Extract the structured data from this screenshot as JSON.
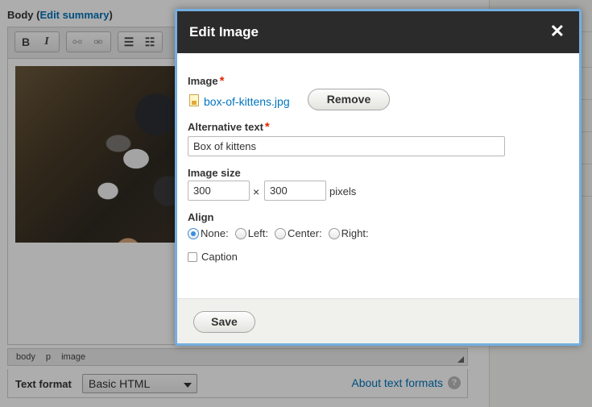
{
  "editor": {
    "body_label": "Body",
    "edit_summary_link": "Edit summary",
    "status_path": [
      "body",
      "p",
      "image"
    ],
    "text_format_label": "Text format",
    "text_format_value": "Basic HTML",
    "about_formats_link": "About text formats",
    "help_glyph": "?"
  },
  "toolbar": {
    "bold": "B",
    "italic": "I",
    "link_icon": "link-icon",
    "unlink_icon": "unlink-icon",
    "bullet_icon": "bulleted-list-icon",
    "number_icon": "numbered-list-icon"
  },
  "dialog": {
    "title": "Edit Image",
    "close_glyph": "✕",
    "image_label": "Image",
    "required_mark": "*",
    "file_name": "box-of-kittens.jpg",
    "remove_button": "Remove",
    "alt_label": "Alternative text",
    "alt_value": "Box of kittens",
    "size_label": "Image size",
    "width_value": "300",
    "height_value": "300",
    "times_glyph": "×",
    "pixels_label": "pixels",
    "align_label": "Align",
    "align_options": [
      "None:",
      "Left:",
      "Center:",
      "Right:"
    ],
    "align_selected": "None:",
    "caption_label": "Caption",
    "save_button": "Save"
  },
  "colors": {
    "link": "#0074bd",
    "required": "#e32700",
    "dialog_title_bg": "#2b2b2b",
    "dialog_border": "#74aee0"
  }
}
